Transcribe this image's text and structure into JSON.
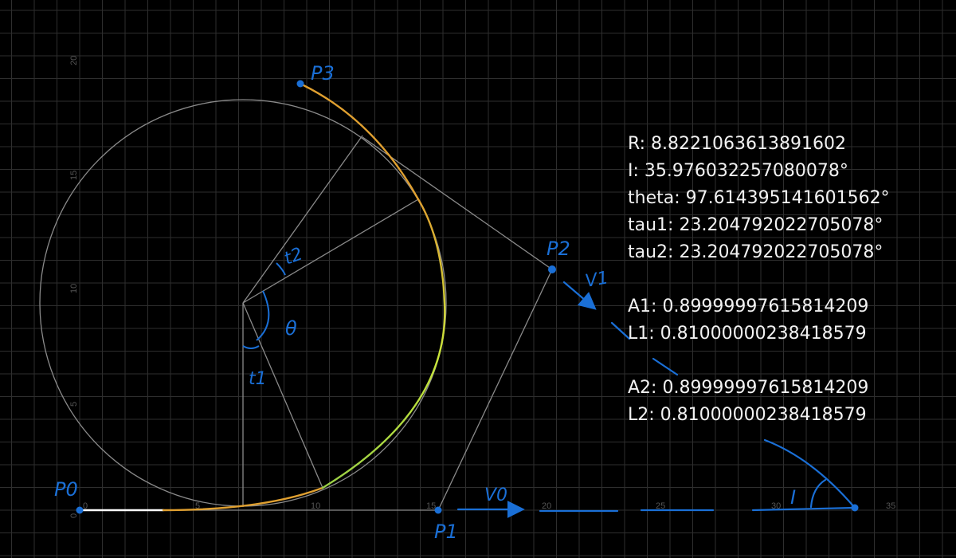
{
  "diagram": {
    "axis_ticks_x": [
      "0",
      "5",
      "10",
      "15",
      "20",
      "25",
      "30",
      "35"
    ],
    "axis_ticks_y": [
      "0",
      "5",
      "10",
      "15",
      "20"
    ],
    "handwritten_labels": {
      "p0": "P0",
      "p1": "P1",
      "p2": "P2",
      "p3": "P3",
      "v0": "V0",
      "v1": "V1",
      "theta": "θ",
      "t1": "t1",
      "t2": "t2",
      "angle_i": "I"
    },
    "colors": {
      "background": "#000000",
      "grid": "#2e2e2e",
      "construction_lines": "#8a8a8a",
      "curve_orange": "#e0a030",
      "curve_green": "#b5e040",
      "ink_blue": "#1a6fd6",
      "readout_text": "#f2f2f2"
    }
  },
  "readout": {
    "R": "R: 8.8221063613891602",
    "I": "I: 35.976032257080078°",
    "theta": "theta: 97.614395141601562°",
    "tau1": "tau1: 23.204792022705078°",
    "tau2": "tau2: 23.204792022705078°",
    "A1": "A1: 0.89999997615814209",
    "L1": "L1: 0.81000000238418579",
    "A2": "A2: 0.89999997615814209",
    "L2": "L2: 0.81000000238418579"
  }
}
